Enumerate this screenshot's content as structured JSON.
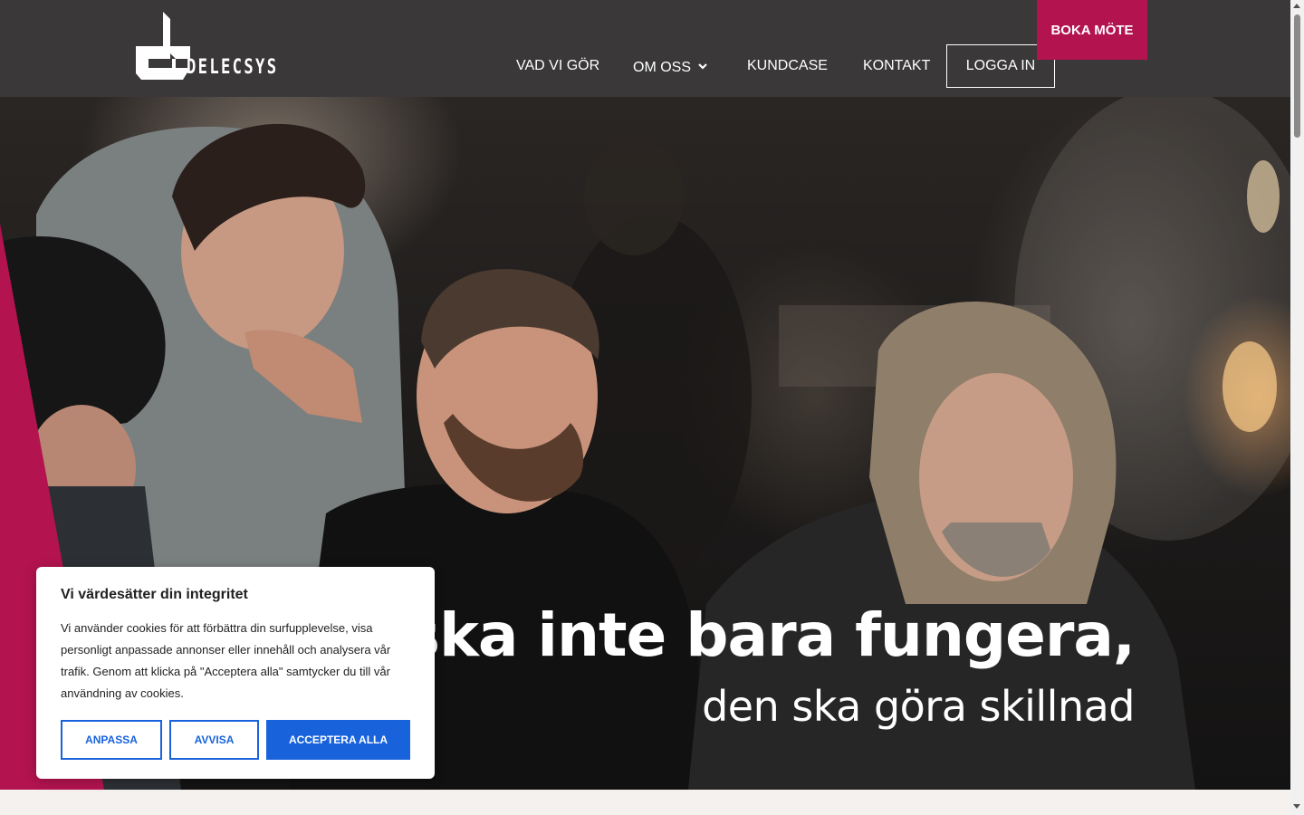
{
  "brand": {
    "name": "DELECSYS",
    "accent": "#b3134f",
    "header_bg": "#3a3839"
  },
  "nav": {
    "items": [
      {
        "label": "VAD VI GÖR"
      },
      {
        "label": "OM OSS",
        "has_dropdown": true
      },
      {
        "label": "KUNDCASE"
      },
      {
        "label": "KONTAKT"
      }
    ],
    "login_label": "LOGGA IN",
    "cta_label": "BOKA MÖTE"
  },
  "hero": {
    "headline": "Det ska inte bara fungera,",
    "subline": "den ska göra skillnad"
  },
  "cookie_banner": {
    "title": "Vi värdesätter din integritet",
    "text": "Vi använder cookies för att förbättra din surfupplevelse, visa personligt anpassade annonser eller innehåll och analysera vår trafik. Genom att klicka på \"Acceptera alla\" samtycker du till vår användning av cookies.",
    "customize_label": "ANPASSA",
    "reject_label": "AVVISA",
    "accept_label": "ACCEPTERA ALLA",
    "button_color": "#1863dc"
  },
  "icons": [
    "delecsys-logo",
    "chevron-down-icon",
    "scroll-up-arrow-icon",
    "scroll-down-arrow-icon"
  ]
}
